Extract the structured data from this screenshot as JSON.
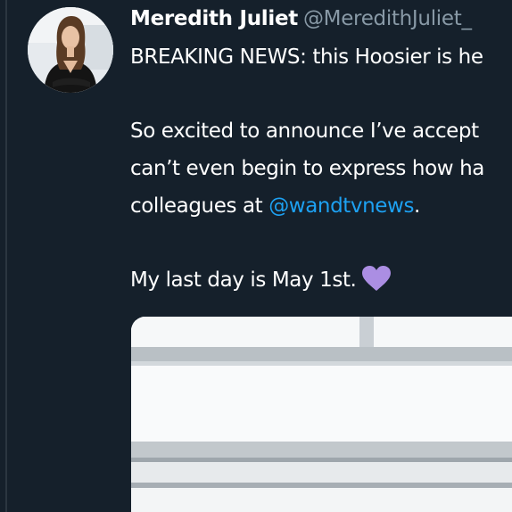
{
  "tweet": {
    "author": {
      "display_name": "Meredith Juliet",
      "handle": "@MeredithJuliet_"
    },
    "lines": {
      "l1": "BREAKING NEWS: this Hoosier is he",
      "l2": "So excited to announce I’ve accept",
      "l3": "can’t even begin to express how ha",
      "l4_before": "colleagues at ",
      "l4_mention": "@wandtvnews",
      "l4_after": ".",
      "l5": "My last day is May 1st."
    },
    "emoji": "purple-heart-icon"
  },
  "colors": {
    "background": "#15202b",
    "text": "#ffffff",
    "handle": "#8899a6",
    "mention": "#1da1f2",
    "heart": "#ab8ee3"
  }
}
